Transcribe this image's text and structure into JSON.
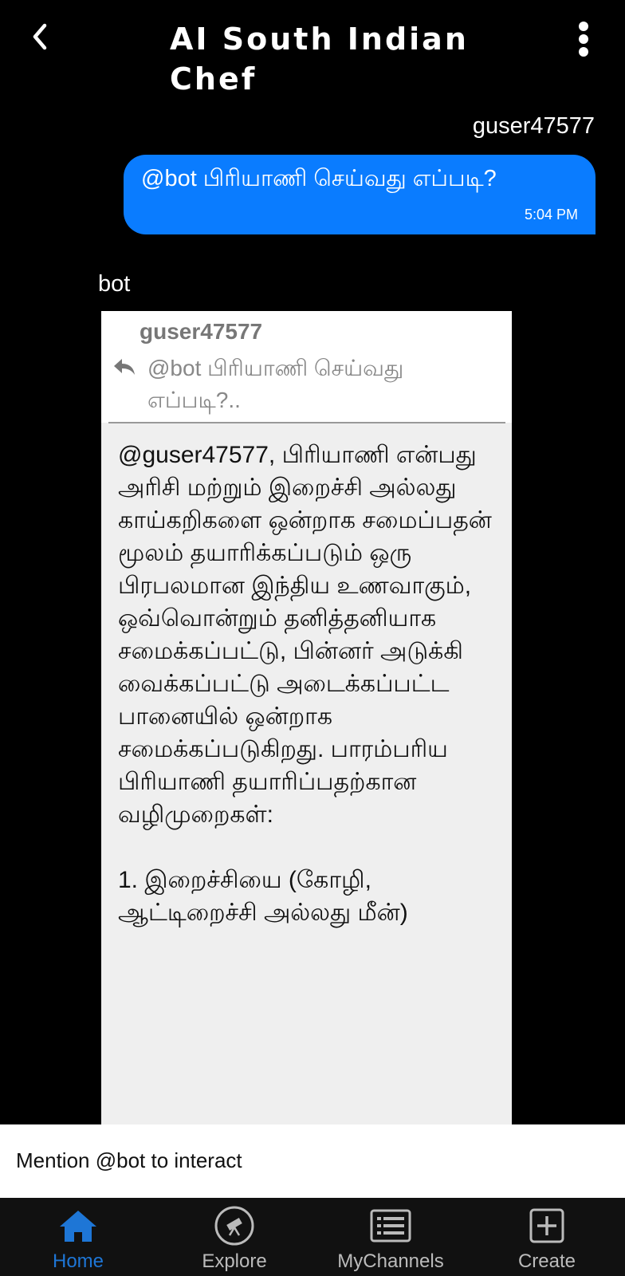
{
  "header": {
    "title": "AI South Indian Chef"
  },
  "messages": {
    "user": {
      "sender": "guser47577",
      "text": "@bot பிரியாணி செய்வது எப்படி?",
      "time": "5:04 PM"
    },
    "bot": {
      "sender": "bot",
      "reply_to_user": "guser47577",
      "reply_to_text": "@bot பிரியாணி செய்வது எப்படி?..",
      "text": "@guser47577, பிரியாணி என்பது அரிசி மற்றும் இறைச்சி அல்லது காய்கறிகளை ஒன்றாக சமைப்பதன் மூலம் தயாரிக்கப்படும் ஒரு பிரபலமான இந்திய உணவாகும், ஒவ்வொன்றும் தனித்தனியாக சமைக்கப்பட்டு, பின்னர் அடுக்கி வைக்கப்பட்டு அடைக்கப்பட்ட பானையில் ஒன்றாக சமைக்கப்படுகிறது. பாரம்பரிய பிரியாணி தயாரிப்பதற்கான வழிமுறைகள்:\n\n1. இறைச்சியை (கோழி, ஆட்டிறைச்சி அல்லது மீன்)"
    }
  },
  "input": {
    "placeholder": "Mention @bot to interact"
  },
  "nav": {
    "items": [
      {
        "label": "Home",
        "icon": "home-icon",
        "active": true
      },
      {
        "label": "Explore",
        "icon": "explore-icon",
        "active": false
      },
      {
        "label": "MyChannels",
        "icon": "channels-icon",
        "active": false
      },
      {
        "label": "Create",
        "icon": "create-icon",
        "active": false
      }
    ]
  },
  "colors": {
    "accent": "#1e76d6",
    "user_bubble": "#0a7cff",
    "bot_card": "#efefef"
  }
}
